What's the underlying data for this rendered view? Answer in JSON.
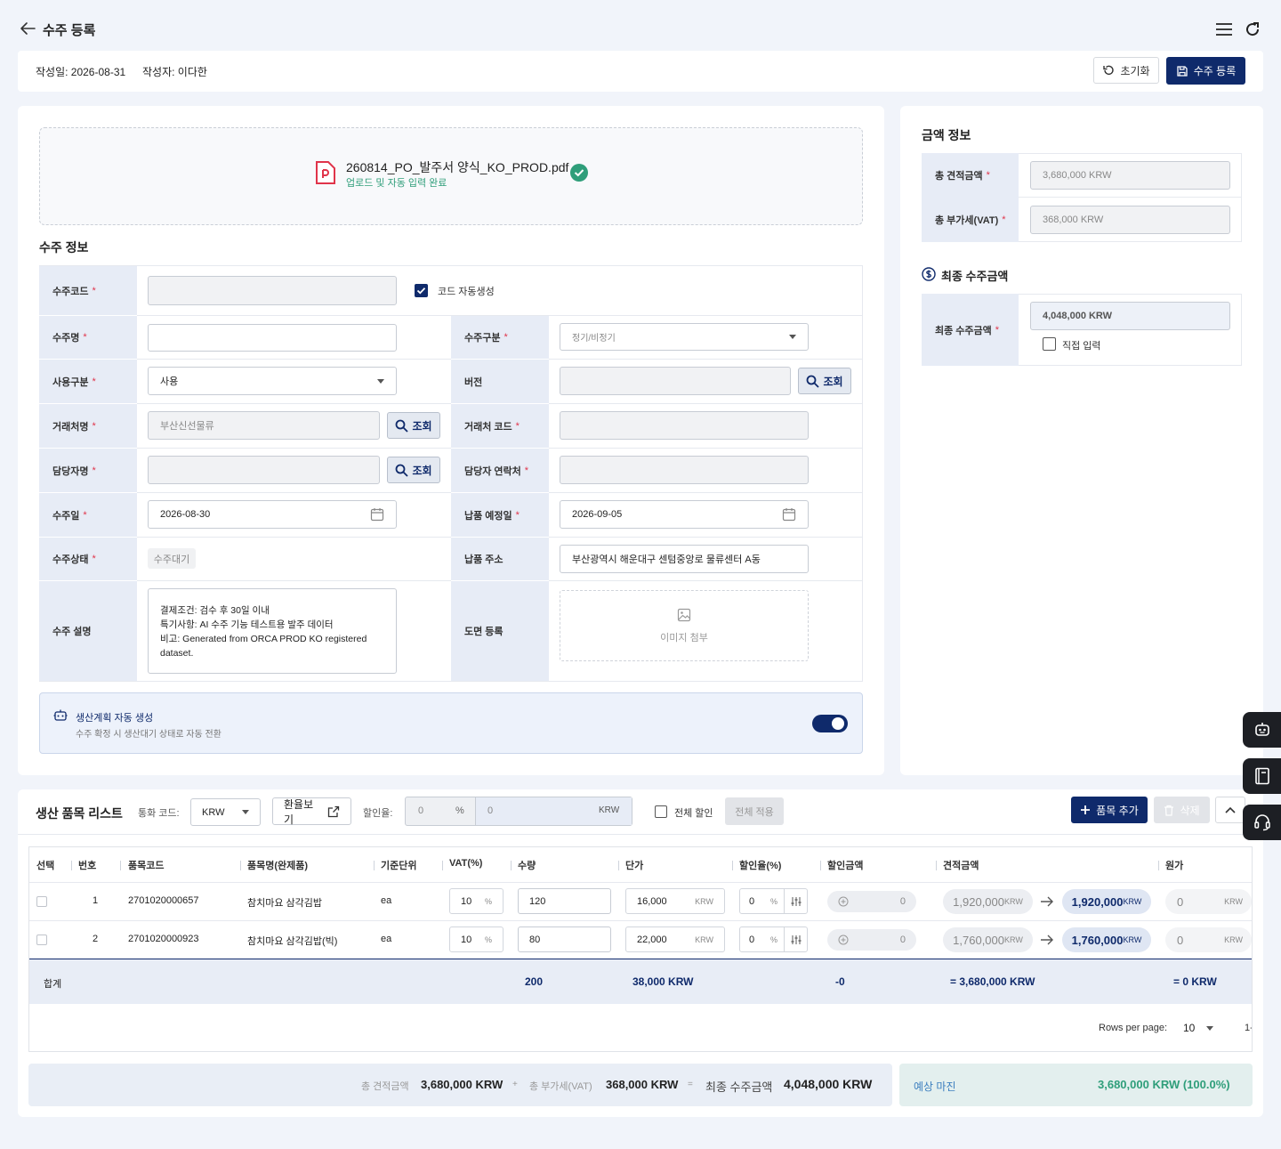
{
  "header": {
    "title": "수주 등록"
  },
  "meta": {
    "created_date": "작성일: 2026-08-31",
    "author": "작성자: 이다한",
    "reset_label": "초기화",
    "submit_label": "수주 등록"
  },
  "upload": {
    "file_name": "260814_PO_발주서 양식_KO_PROD.pdf",
    "status": "업로드 및 자동 입력 완료"
  },
  "order_info": {
    "title": "수주 정보",
    "required_mark": "*",
    "search_label": "조회",
    "labels": {
      "code": "수주코드",
      "auto_code": "코드 자동생성",
      "name": "수주명",
      "category": "수주구분",
      "use_type": "사용구분",
      "version": "버전",
      "client_name": "거래처명",
      "client_code": "거래처 코드",
      "manager": "담당자명",
      "manager_contact": "담당자 연락처",
      "order_date": "수주일",
      "due_date": "납품 예정일",
      "status": "수주상태",
      "address": "납품 주소",
      "description": "수주 설명",
      "drawing": "도면 등록"
    },
    "values": {
      "code": "",
      "auto_code_checked": true,
      "name": "",
      "category_placeholder": "정기/비정기",
      "use_type": "사용",
      "version": "",
      "client_name": "부산신선물류",
      "client_code": "",
      "manager": "",
      "manager_contact": "",
      "order_date": "2026-08-30",
      "due_date": "2026-09-05",
      "status": "수주대기",
      "address": "부산광역시 해운대구 센텀중앙로 물류센터 A동",
      "description": [
        "결제조건: 검수 후 30일 이내",
        "특기사항: AI 수주 기능 테스트용 발주 데이터",
        "비고: Generated from ORCA PROD KO registered",
        "dataset."
      ],
      "image_attach": "이미지 첨부"
    },
    "production_plan": {
      "title": "생산계획 자동 생성",
      "subtitle": "수주 확정 시 생산대기 상태로 자동 전환",
      "enabled": true
    }
  },
  "amount_info": {
    "title": "금액 정보",
    "total_quote_label": "총 견적금액",
    "total_quote": "3,680,000 KRW",
    "total_vat_label": "총 부가세(VAT)",
    "total_vat": "368,000 KRW",
    "final_title": "최종 수주금액",
    "final_label": "최종 수주금액",
    "final_amount": "4,048,000 KRW",
    "manual_input_label": "직접 입력",
    "manual_input_checked": false
  },
  "items": {
    "title": "생산 품목 리스트",
    "currency_label": "통화 코드:",
    "currency": "KRW",
    "exchange_label": "환율보기",
    "discount_label": "할인율:",
    "discount_rate": "0",
    "percent": "%",
    "discount_amount": "0",
    "discount_unit": "KRW",
    "all_discount_label": "전체 할인",
    "apply_all_label": "전체 적용",
    "add_label": "품목 추가",
    "delete_label": "삭제",
    "columns": [
      "선택",
      "번호",
      "품목코드",
      "품목명(완제품)",
      "기준단위",
      "VAT(%)",
      "수량",
      "단가",
      "할인율(%)",
      "할인금액",
      "견적금액",
      "원가"
    ],
    "unit_krw": "KRW",
    "rows": [
      {
        "no": "1",
        "code": "2701020000657",
        "name": "참치마요 삼각김밥",
        "unit": "ea",
        "vat": "10",
        "qty": "120",
        "price": "16,000",
        "discount_rate": "0",
        "discount_amount": "0",
        "quote_before": "1,920,000",
        "quote_after": "1,920,000",
        "cost": "0"
      },
      {
        "no": "2",
        "code": "2701020000923",
        "name": "참치마요 삼각김밥(빅)",
        "unit": "ea",
        "vat": "10",
        "qty": "80",
        "price": "22,000",
        "discount_rate": "0",
        "discount_amount": "0",
        "quote_before": "1,760,000",
        "quote_after": "1,760,000",
        "cost": "0"
      }
    ],
    "totals": {
      "label": "합계",
      "qty": "200",
      "price": "38,000 KRW",
      "discount": "-0",
      "quote": "= 3,680,000 KRW",
      "cost": "= 0 KRW"
    },
    "pagination": {
      "rows_per_page_label": "Rows per page:",
      "rows_per_page": "10",
      "range": "1-"
    }
  },
  "summary": {
    "quote_label": "총 견적금액",
    "quote": "3,680,000 KRW",
    "plus": "+",
    "vat_label": "총 부가세(VAT)",
    "vat": "368,000 KRW",
    "equals": "=",
    "final_label": "최종 수주금액",
    "final": "4,048,000 KRW",
    "margin_label": "예상 마진",
    "margin": "3,680,000 KRW (100.0%)"
  },
  "colors": {
    "primary": "#0f2a6b",
    "required": "#e0344a",
    "success": "#2f9e7a",
    "label_bg": "#e7ecf6"
  }
}
